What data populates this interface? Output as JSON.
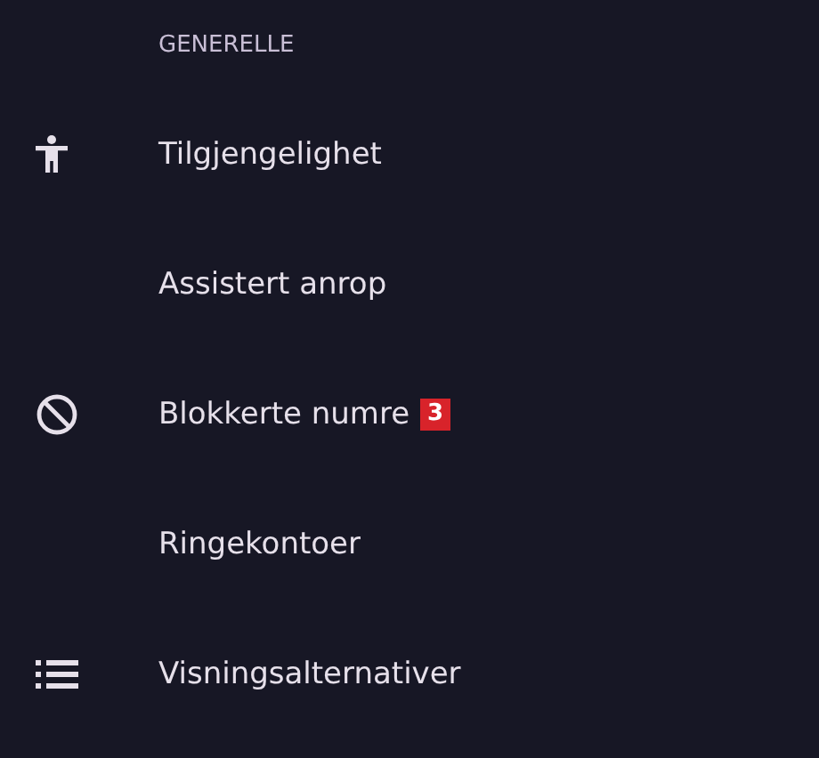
{
  "section": {
    "title": "GENERELLE"
  },
  "items": [
    {
      "label": "Tilgjengelighet",
      "kind": "accessibility"
    },
    {
      "label": "Assistert anrop",
      "kind": "plain"
    },
    {
      "label": "Blokkerte numre",
      "kind": "block",
      "badge": "3"
    },
    {
      "label": "Ringekontoer",
      "kind": "plain"
    },
    {
      "label": "Visningsalternativer",
      "kind": "list"
    }
  ]
}
